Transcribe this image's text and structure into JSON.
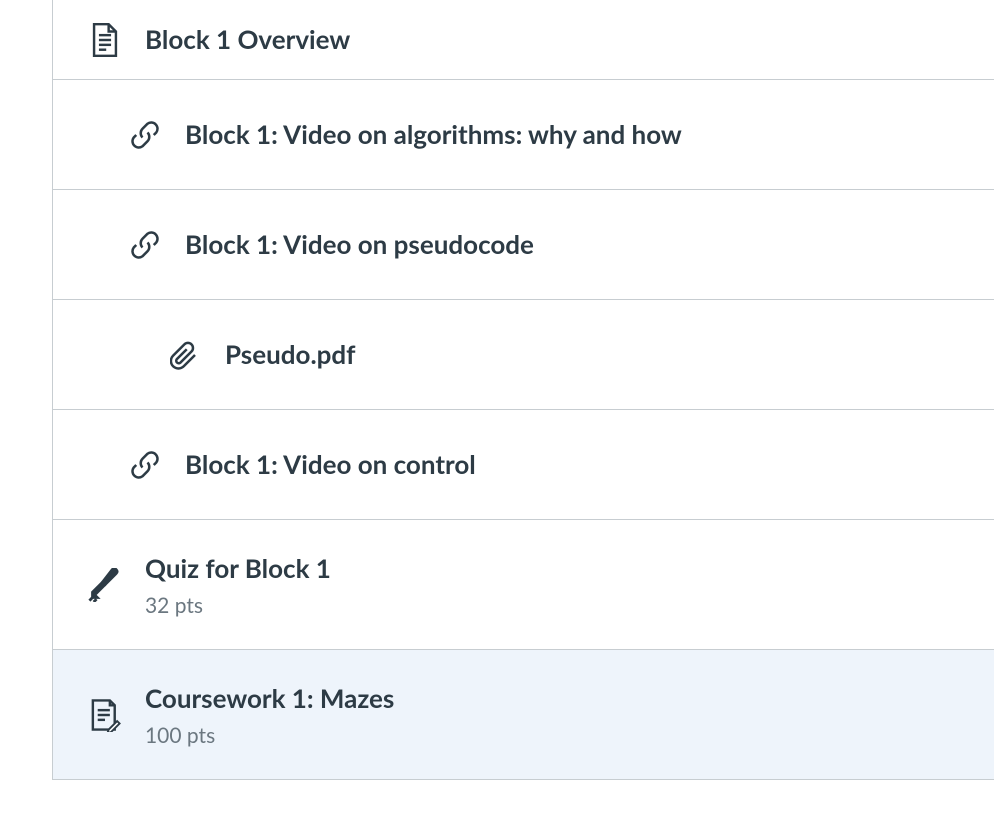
{
  "items": [
    {
      "title": "Block 1 Overview",
      "icon": "page-icon",
      "indent": 0,
      "meta": "",
      "highlighted": false
    },
    {
      "title": "Block 1: Video on algorithms: why and how",
      "icon": "link-icon",
      "indent": 1,
      "meta": "",
      "highlighted": false
    },
    {
      "title": "Block 1: Video on pseudocode",
      "icon": "link-icon",
      "indent": 1,
      "meta": "",
      "highlighted": false
    },
    {
      "title": "Pseudo.pdf",
      "icon": "attachment-icon",
      "indent": 2,
      "meta": "",
      "highlighted": false
    },
    {
      "title": "Block 1: Video on control",
      "icon": "link-icon",
      "indent": 1,
      "meta": "",
      "highlighted": false
    },
    {
      "title": "Quiz for Block 1",
      "icon": "quiz-icon",
      "indent": 0,
      "meta": "32 pts",
      "highlighted": false
    },
    {
      "title": "Coursework 1: Mazes",
      "icon": "assignment-icon",
      "indent": 0,
      "meta": "100 pts",
      "highlighted": true
    }
  ]
}
